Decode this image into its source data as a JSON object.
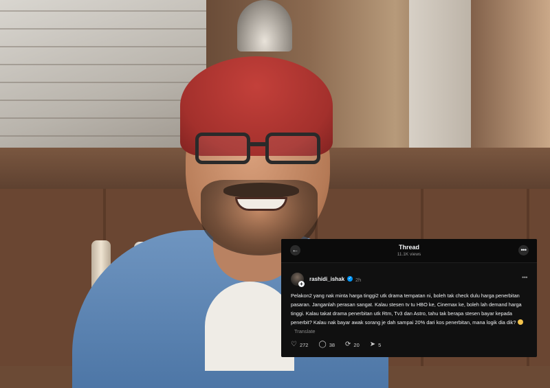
{
  "thread": {
    "title": "Thread",
    "views": "11.1K views",
    "back_icon": "arrow-left-icon",
    "menu_icon": "more-horizontal-icon"
  },
  "post": {
    "username": "rashidi_ishak",
    "verified": true,
    "time": "2h",
    "text": "Pelakon2 yang nak minta harga tinggi2 utk drama tempatan ni, boleh tak check dulu harga penerbitan pasaran. Janganlah perasan sangat. Kalau stesen tv tu HBO ke, Cinemax ke, boleh lah demand harga tinggi. Kalau takat drama penerbitan utk Rtm, Tv3 dan Astro, tahu tak berapa stesen bayar kepada penerbit? Kalau nak bayar awak sorang je dah sampai 20% dari kos penerbitan, mana logik dia dik?",
    "emoji": "grinning-sweat-emoji",
    "translate_label": "Translate",
    "actions": {
      "likes": "272",
      "comments": "38",
      "reposts": "20",
      "shares": "5"
    }
  },
  "colors": {
    "card_bg": "#101010",
    "text": "#f3f5f7",
    "muted": "#8a8a8a",
    "verified": "#0095f6"
  }
}
